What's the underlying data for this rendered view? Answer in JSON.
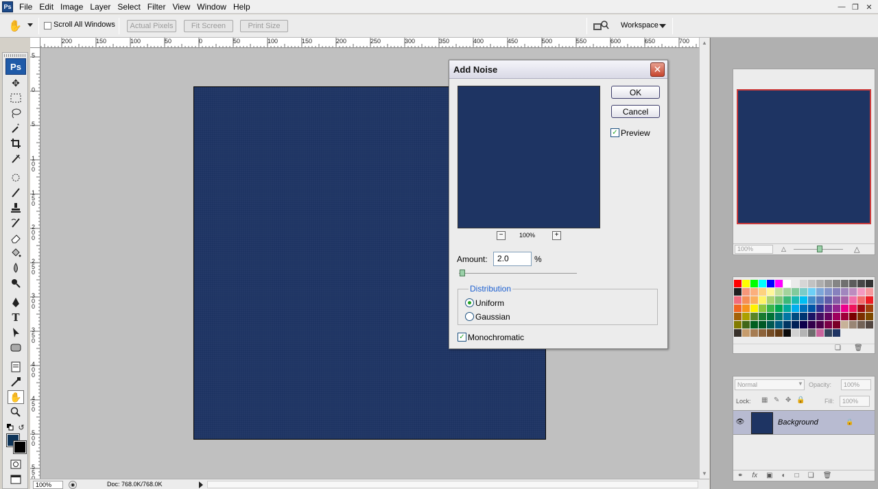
{
  "menu": {
    "items": [
      "File",
      "Edit",
      "Image",
      "Layer",
      "Select",
      "Filter",
      "View",
      "Window",
      "Help"
    ]
  },
  "options_bar": {
    "scroll_all_windows": "Scroll All Windows",
    "actual_pixels": "Actual Pixels",
    "fit_screen": "Fit Screen",
    "print_size": "Print Size",
    "workspace": "Workspace"
  },
  "toolbox": {
    "logo": "Ps",
    "type_tool_glyph": "T"
  },
  "rulers": {
    "horizontal": [
      "200",
      "150",
      "100",
      "50",
      "0",
      "50",
      "100",
      "150",
      "200",
      "250",
      "300",
      "350",
      "400",
      "450",
      "500",
      "550",
      "600",
      "650",
      "700"
    ],
    "vertical": [
      "5",
      "0",
      "5",
      "1 0 0",
      "1 5 0",
      "2 0 0",
      "2 5 0",
      "3 0 0",
      "3 5 0",
      "4 0 0",
      "4 5 0",
      "5 0 0",
      "5 5 0"
    ]
  },
  "status_bar": {
    "zoom": "100%",
    "doc": "Doc: 768.0K/768.0K"
  },
  "navigator": {
    "zoom": "100%"
  },
  "swatches": {
    "colors": [
      "#ff0000",
      "#ffff00",
      "#00ff00",
      "#00ffff",
      "#0000ff",
      "#ff00ff",
      "#ffffff",
      "#ebebeb",
      "#d6d6d6",
      "#c2c2c2",
      "#adadad",
      "#999999",
      "#858585",
      "#707070",
      "#5c5c5c",
      "#474747",
      "#333333",
      "#1f1f1f",
      "#f7977a",
      "#fbaf7d",
      "#fdd27f",
      "#fff79a",
      "#c4df9b",
      "#a3d39c",
      "#82ca9c",
      "#7accc8",
      "#6dcff6",
      "#7da7d9",
      "#8393ca",
      "#8781bd",
      "#a186be",
      "#bd8cbf",
      "#f49ac1",
      "#f6989d",
      "#f26d7d",
      "#f68e56",
      "#fbaf5d",
      "#fff467",
      "#acd372",
      "#7cc576",
      "#3bb878",
      "#1abbb4",
      "#00bff3",
      "#438cca",
      "#5574b9",
      "#605ca8",
      "#855fa8",
      "#a763a8",
      "#f06ea9",
      "#f26c6d",
      "#ed1c24",
      "#f26522",
      "#f7941d",
      "#fff200",
      "#8dc73f",
      "#39b54a",
      "#00a651",
      "#00a99d",
      "#00aeef",
      "#0072bc",
      "#0054a6",
      "#2e3192",
      "#662d91",
      "#92278f",
      "#ec008c",
      "#ed145b",
      "#9e0b0f",
      "#a0410d",
      "#a36209",
      "#aba000",
      "#598527",
      "#197b30",
      "#007236",
      "#00746b",
      "#0076a3",
      "#004b80",
      "#003471",
      "#1b1464",
      "#440e62",
      "#630460",
      "#9e005d",
      "#9e0039",
      "#790000",
      "#7b2e00",
      "#7d4900",
      "#827b00",
      "#406618",
      "#005e20",
      "#005826",
      "#005952",
      "#005b7f",
      "#003663",
      "#002157",
      "#0d004c",
      "#32004b",
      "#4b0049",
      "#7b0046",
      "#7a0026",
      "#c7b299",
      "#998675",
      "#736357",
      "#534741",
      "#37302a",
      "#c69c6d",
      "#a67c52",
      "#8c6239",
      "#754c24",
      "#603913",
      "#0a0a0a",
      "#d2d2d2",
      "#b4b4b4",
      "#6d6d6d",
      "#c8649c",
      "#34445c",
      "#1e3463"
    ]
  },
  "layers": {
    "blend_mode": "Normal",
    "opacity_label": "Opacity:",
    "opacity": "100%",
    "lock_label": "Lock:",
    "fill_label": "Fill:",
    "fill": "100%",
    "layer_name": "Background"
  },
  "dialog": {
    "title": "Add Noise",
    "ok": "OK",
    "cancel": "Cancel",
    "preview_label": "Preview",
    "preview_checked": true,
    "zoom": "100%",
    "amount_label": "Amount:",
    "amount_value": "2.0",
    "amount_unit": "%",
    "amount_fraction": 0.005,
    "distribution_label": "Distribution",
    "uniform_label": "Uniform",
    "gaussian_label": "Gaussian",
    "selected_distribution": "Uniform",
    "monochromatic_label": "Monochromatic",
    "monochromatic_checked": true
  },
  "colors": {
    "document": "#1e3463",
    "foreground": "#0e3458",
    "background": "#000000",
    "accent": "#1c5fd0",
    "close_button": "#c6452e",
    "nav_frame": "#cc3b3b"
  }
}
